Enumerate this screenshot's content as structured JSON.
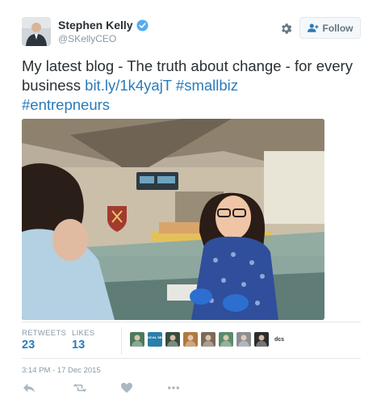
{
  "author": {
    "name": "Stephen Kelly",
    "handle": "@SKellyCEO"
  },
  "follow_button": {
    "label": "Follow"
  },
  "tweet": {
    "text_plain": "My latest blog - The truth about change - for every business ",
    "link_url": "bit.ly/1k4yajT",
    "hashtag_1": "#smallbiz",
    "hashtag_2": "#entrepneurs"
  },
  "stats": {
    "retweets_label": "RETWEETS",
    "retweets_count": "23",
    "likes_label": "LIKES",
    "likes_count": "13"
  },
  "retweeter_avatars": [
    {
      "label": "",
      "color": "#4d7a5a"
    },
    {
      "label": "LOCAL SEO",
      "color": "#2a7fa8"
    },
    {
      "label": "",
      "color": "#3a4a3f"
    },
    {
      "label": "",
      "color": "#b07840"
    },
    {
      "label": "",
      "color": "#7a6a5a"
    },
    {
      "label": "",
      "color": "#5b8b6c"
    },
    {
      "label": "",
      "color": "#8a8f94"
    },
    {
      "label": "",
      "color": "#2c2c2c"
    },
    {
      "label": "dcs",
      "color": "#ffffff"
    }
  ],
  "timestamp": "3:14 PM - 17 Dec 2015",
  "colors": {
    "link": "#2b7bb9",
    "verified": "#55acee",
    "muted": "#8899a6",
    "action_icon": "#aab8c2"
  },
  "icons": {
    "verified": "verified-badge-icon",
    "gear": "gear-icon",
    "follow": "add-user-icon",
    "reply": "reply-icon",
    "retweet": "retweet-icon",
    "like": "heart-icon",
    "more": "more-dots-icon"
  }
}
